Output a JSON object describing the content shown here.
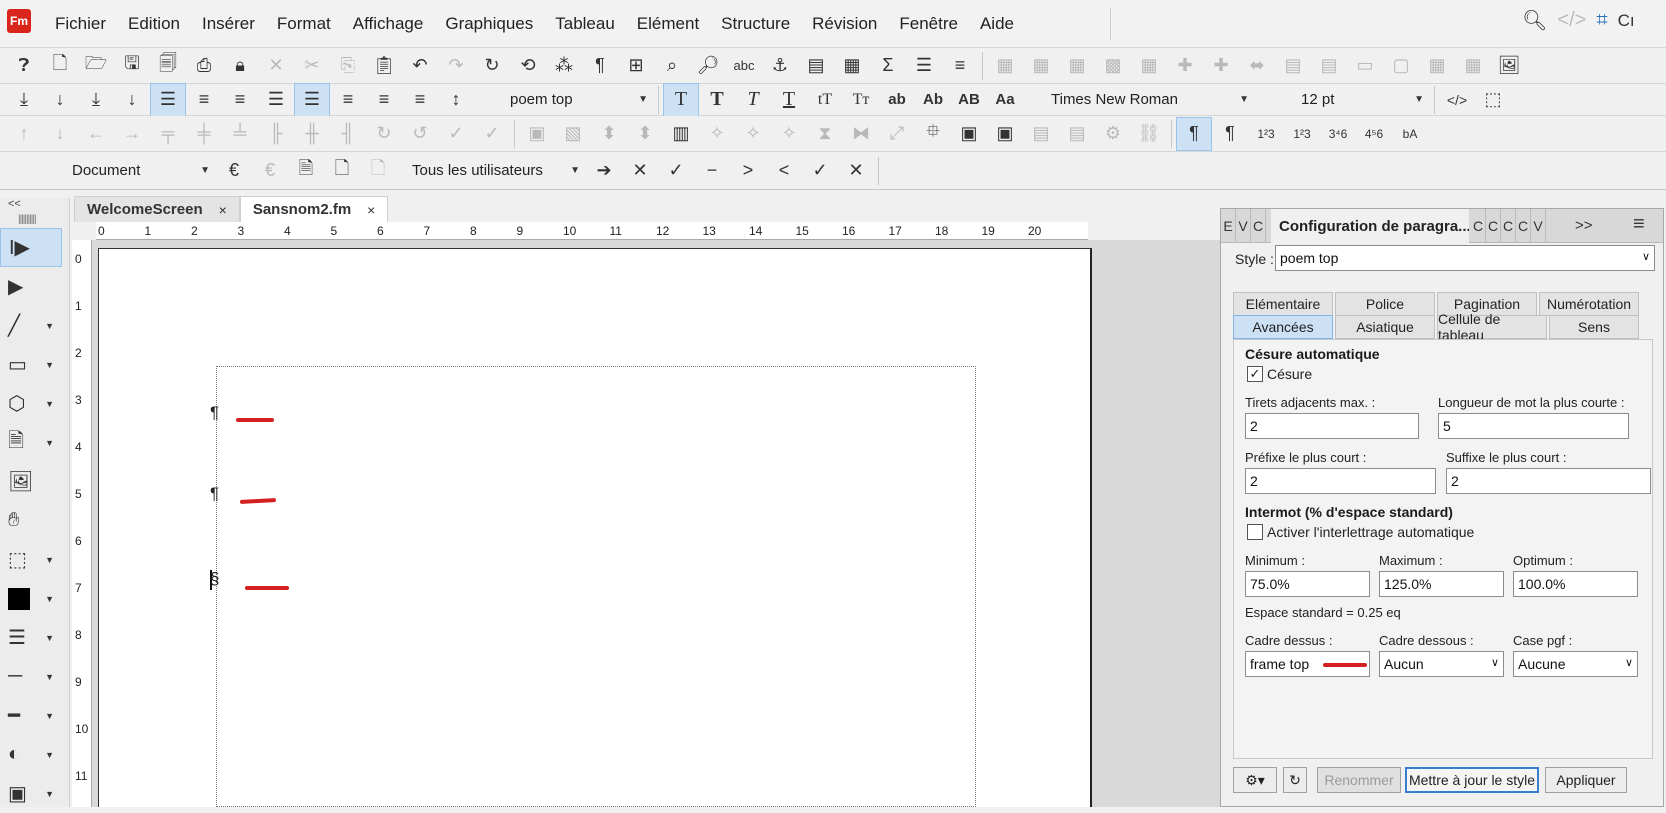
{
  "app": {
    "logo_text": "Fm"
  },
  "menu": {
    "items": [
      "Fichier",
      "Edition",
      "Insérer",
      "Format",
      "Affichage",
      "Graphiques",
      "Tableau",
      "Elément",
      "Structure",
      "Révision",
      "Fenêtre",
      "Aide"
    ],
    "right_text": "Cı"
  },
  "toolbar": {
    "paragraph_style": "poem top",
    "font_family": "Times New Roman",
    "font_size": "12 pt",
    "format_buttons": [
      "T",
      "T",
      "T",
      "T",
      "tT",
      "Tт",
      "ab",
      "Ab",
      "AB",
      "Aa"
    ],
    "doc_scope": "Document",
    "users": "Tous les utilisateurs"
  },
  "tabs": [
    {
      "label": "WelcomeScreen",
      "close": "×"
    },
    {
      "label": "Sansnom2.fm",
      "close": "×"
    }
  ],
  "ruler": {
    "h_marks": [
      "0",
      "1",
      "2",
      "3",
      "4",
      "5",
      "6",
      "7",
      "8",
      "9",
      "10",
      "11",
      "12",
      "13",
      "14",
      "15",
      "16",
      "17",
      "18",
      "19",
      "20"
    ],
    "v_marks": [
      "0",
      "1",
      "2",
      "3",
      "4",
      "5",
      "6",
      "7",
      "8",
      "9",
      "10",
      "11"
    ]
  },
  "document": {
    "pilcrow": "¶",
    "section_mark": "§"
  },
  "panel": {
    "mini_tabs_left": [
      "E",
      "V",
      "C"
    ],
    "title": "Configuration de paragra...",
    "mini_tabs_right": [
      "C",
      "C",
      "C",
      "C",
      "V"
    ],
    "overflow": ">>",
    "style_label": "Style :",
    "style_value": "poem top",
    "tabs_row1": [
      "Elémentaire",
      "Police",
      "Pagination",
      "Numérotation"
    ],
    "tabs_row2": [
      "Avancées",
      "Asiatique",
      "Cellule de tableau",
      "Sens"
    ],
    "hyphen_heading": "Césure automatique",
    "hyphen_check": "Césure",
    "max_adjacent_label": "Tirets adjacents max. :",
    "max_adjacent_value": "2",
    "shortest_word_label": "Longueur de mot la plus courte :",
    "shortest_word_value": "5",
    "shortest_prefix_label": "Préfixe le plus court :",
    "shortest_prefix_value": "2",
    "shortest_suffix_label": "Suffixe le plus court :",
    "shortest_suffix_value": "2",
    "word_spacing_heading": "Intermot (% d'espace standard)",
    "auto_letterspace": "Activer l'interlettrage automatique",
    "minimum_label": "Minimum :",
    "minimum_value": "75.0%",
    "maximum_label": "Maximum :",
    "maximum_value": "125.0%",
    "optimum_label": "Optimum :",
    "optimum_value": "100.0%",
    "standard_space": "Espace standard = 0.25 eq",
    "frame_above_label": "Cadre dessus :",
    "frame_above_value": "frame top",
    "frame_below_label": "Cadre dessous :",
    "frame_below_value": "Aucun",
    "table_cell_label": "Case pgf :",
    "table_cell_value": "Aucune",
    "rename_button": "Renommer",
    "update_button": "Mettre à jour le style",
    "apply_button": "Appliquer"
  },
  "colors": {
    "accent": "#3a7fcf",
    "annotation_red": "#d42020",
    "selected_bg": "#cde1f5"
  }
}
